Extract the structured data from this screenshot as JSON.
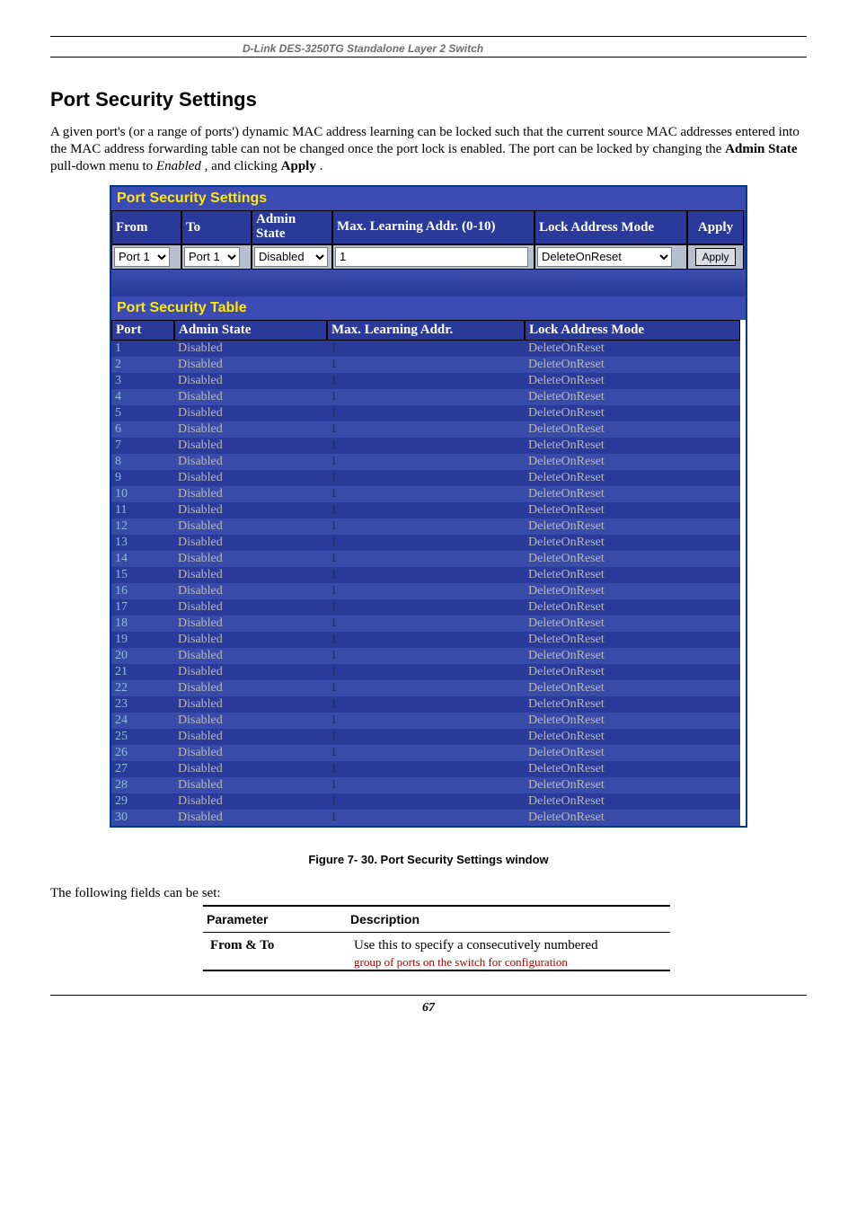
{
  "header": {
    "product": "D-Link DES-3250TG Standalone Layer 2 Switch"
  },
  "section": {
    "title": "Port Security Settings"
  },
  "intro": {
    "t1": "A given port's (or a range of ports') dynamic MAC address learning can be locked such that the current source MAC addresses entered into the MAC address forwarding table can not be changed once the port lock is enabled. The port can be locked by changing the ",
    "b1": "Admin State",
    "t2": " pull-down menu to ",
    "i1": "Enabled",
    "t3": ", and clicking ",
    "b2": "Apply",
    "t4": "."
  },
  "settings_panel": {
    "title": "Port Security Settings",
    "headers": {
      "from": "From",
      "to": "To",
      "admin_state": "Admin State",
      "max_learning": "Max. Learning Addr. (0-10)",
      "lock_mode": "Lock Address Mode",
      "apply": "Apply"
    },
    "controls": {
      "from_value": "Port 1",
      "to_value": "Port 1",
      "admin_state_value": "Disabled",
      "max_value": "1",
      "lock_mode_value": "DeleteOnReset",
      "apply_label": "Apply"
    }
  },
  "table_panel": {
    "title": "Port Security Table",
    "headers": {
      "port": "Port",
      "admin_state": "Admin State",
      "max_learning": "Max. Learning Addr.",
      "lock_mode": "Lock Address Mode"
    },
    "rows": [
      {
        "port": "1",
        "state": "Disabled",
        "max": "1",
        "mode": "DeleteOnReset"
      },
      {
        "port": "2",
        "state": "Disabled",
        "max": "1",
        "mode": "DeleteOnReset"
      },
      {
        "port": "3",
        "state": "Disabled",
        "max": "1",
        "mode": "DeleteOnReset"
      },
      {
        "port": "4",
        "state": "Disabled",
        "max": "1",
        "mode": "DeleteOnReset"
      },
      {
        "port": "5",
        "state": "Disabled",
        "max": "1",
        "mode": "DeleteOnReset"
      },
      {
        "port": "6",
        "state": "Disabled",
        "max": "1",
        "mode": "DeleteOnReset"
      },
      {
        "port": "7",
        "state": "Disabled",
        "max": "1",
        "mode": "DeleteOnReset"
      },
      {
        "port": "8",
        "state": "Disabled",
        "max": "1",
        "mode": "DeleteOnReset"
      },
      {
        "port": "9",
        "state": "Disabled",
        "max": "1",
        "mode": "DeleteOnReset"
      },
      {
        "port": "10",
        "state": "Disabled",
        "max": "1",
        "mode": "DeleteOnReset"
      },
      {
        "port": "11",
        "state": "Disabled",
        "max": "1",
        "mode": "DeleteOnReset"
      },
      {
        "port": "12",
        "state": "Disabled",
        "max": "1",
        "mode": "DeleteOnReset"
      },
      {
        "port": "13",
        "state": "Disabled",
        "max": "1",
        "mode": "DeleteOnReset"
      },
      {
        "port": "14",
        "state": "Disabled",
        "max": "1",
        "mode": "DeleteOnReset"
      },
      {
        "port": "15",
        "state": "Disabled",
        "max": "1",
        "mode": "DeleteOnReset"
      },
      {
        "port": "16",
        "state": "Disabled",
        "max": "1",
        "mode": "DeleteOnReset"
      },
      {
        "port": "17",
        "state": "Disabled",
        "max": "1",
        "mode": "DeleteOnReset"
      },
      {
        "port": "18",
        "state": "Disabled",
        "max": "1",
        "mode": "DeleteOnReset"
      },
      {
        "port": "19",
        "state": "Disabled",
        "max": "1",
        "mode": "DeleteOnReset"
      },
      {
        "port": "20",
        "state": "Disabled",
        "max": "1",
        "mode": "DeleteOnReset"
      },
      {
        "port": "21",
        "state": "Disabled",
        "max": "1",
        "mode": "DeleteOnReset"
      },
      {
        "port": "22",
        "state": "Disabled",
        "max": "1",
        "mode": "DeleteOnReset"
      },
      {
        "port": "23",
        "state": "Disabled",
        "max": "1",
        "mode": "DeleteOnReset"
      },
      {
        "port": "24",
        "state": "Disabled",
        "max": "1",
        "mode": "DeleteOnReset"
      },
      {
        "port": "25",
        "state": "Disabled",
        "max": "1",
        "mode": "DeleteOnReset"
      },
      {
        "port": "26",
        "state": "Disabled",
        "max": "1",
        "mode": "DeleteOnReset"
      },
      {
        "port": "27",
        "state": "Disabled",
        "max": "1",
        "mode": "DeleteOnReset"
      },
      {
        "port": "28",
        "state": "Disabled",
        "max": "1",
        "mode": "DeleteOnReset"
      },
      {
        "port": "29",
        "state": "Disabled",
        "max": "1",
        "mode": "DeleteOnReset"
      },
      {
        "port": "30",
        "state": "Disabled",
        "max": "1",
        "mode": "DeleteOnReset"
      }
    ]
  },
  "figure_caption": "Figure 7- 30.  Port Security Settings window",
  "fields_intro": "The following fields can be set:",
  "param_table": {
    "h_param": "Parameter",
    "h_desc": "Description",
    "rows": [
      {
        "key": "From & To",
        "desc": "Use this to specify a consecutively numbered",
        "cut": "group of ports on the switch for configuration"
      }
    ]
  },
  "page_number": "67"
}
